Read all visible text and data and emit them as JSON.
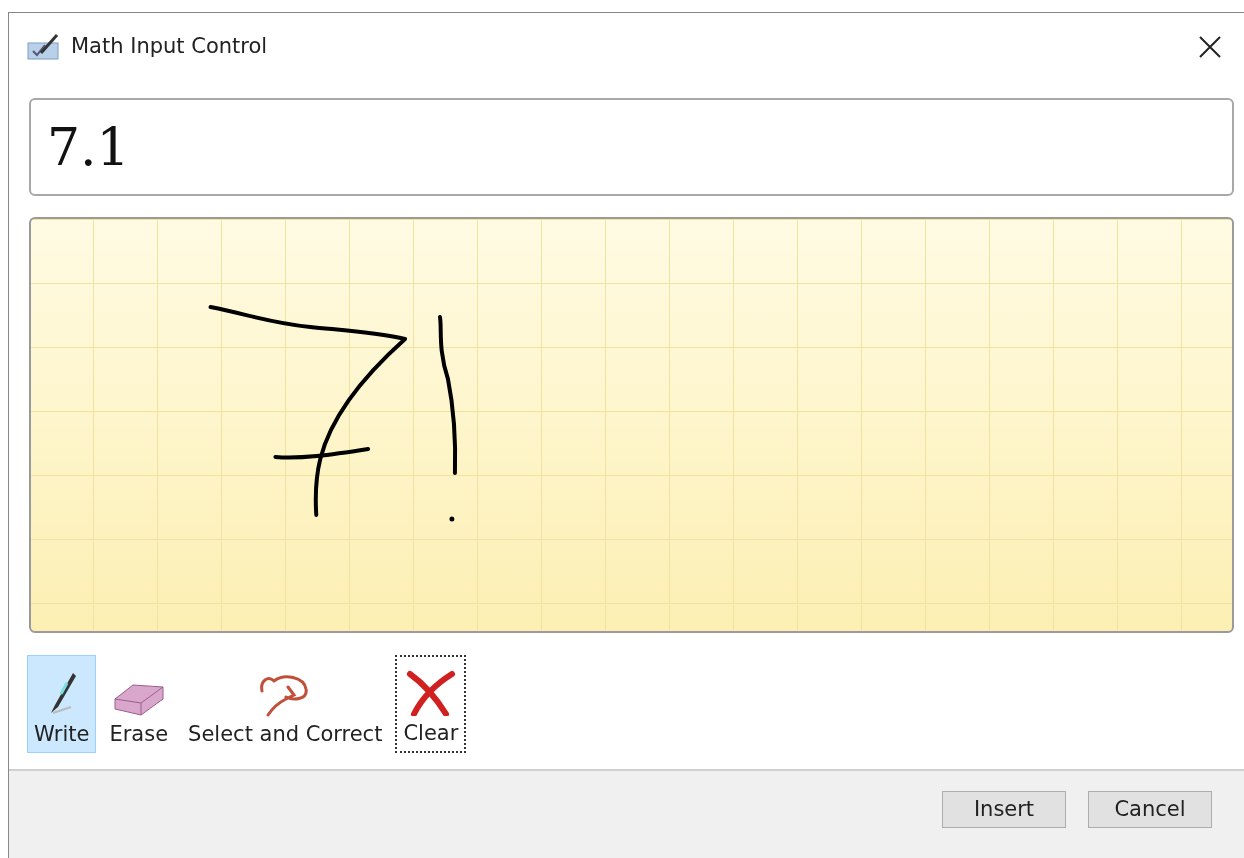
{
  "window": {
    "title": "Math Input Control"
  },
  "result": {
    "value": "7.1"
  },
  "tools": [
    {
      "kind": "pen",
      "label": "Write",
      "selected": true,
      "focused": false
    },
    {
      "kind": "eraser",
      "label": "Erase",
      "selected": false,
      "focused": false
    },
    {
      "kind": "lasso",
      "label": "Select and Correct",
      "selected": false,
      "focused": false
    },
    {
      "kind": "clear",
      "label": "Clear",
      "selected": false,
      "focused": true
    }
  ],
  "buttons": [
    {
      "label": "Insert"
    },
    {
      "label": "Cancel"
    }
  ]
}
